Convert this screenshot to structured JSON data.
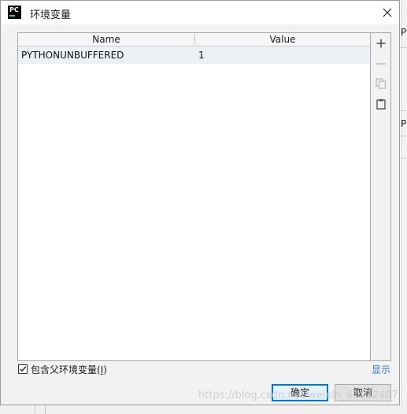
{
  "window": {
    "app_icon_text": "PC",
    "title": "环境变量"
  },
  "table": {
    "columns": [
      "Name",
      "Value"
    ],
    "rows": [
      {
        "name": "PYTHONUNBUFFERED",
        "value": "1"
      }
    ]
  },
  "toolbar": {
    "buttons": [
      "add",
      "remove",
      "copy",
      "paste"
    ]
  },
  "footer": {
    "include_parent_label": "包含父环境变量(",
    "include_parent_mnemonic": "I",
    "include_parent_suffix": ")",
    "include_parent_checked": true,
    "show_link": "显示",
    "ok_label": "确定",
    "cancel_label": "取消"
  },
  "background": {
    "fragment_1": "Py",
    "fragment_2": "P"
  },
  "watermark": "https://blog.csdn.net/weixin_41532407",
  "colors": {
    "link": "#2f7bc4",
    "selected_row": "#edf0f5",
    "default_button_border": "#0078d7"
  }
}
